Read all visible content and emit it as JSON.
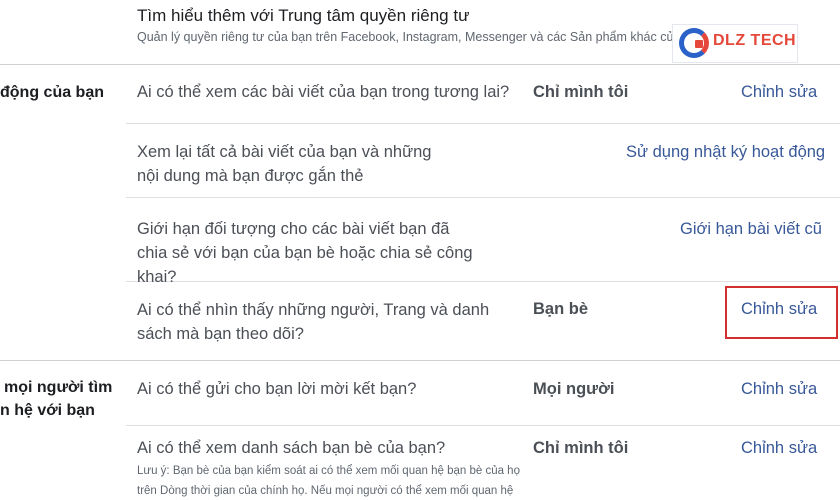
{
  "header": {
    "title": "Tìm hiểu thêm với Trung tâm quyền riêng tư",
    "subtitle": "Quản lý quyền riêng tư của bạn trên Facebook, Instagram, Messenger và các Sản phẩm khác của Meta"
  },
  "watermark": {
    "brand": "DLZ TECH"
  },
  "sections": [
    {
      "label": "động của bạn",
      "rows": [
        {
          "question": "Ai có thể xem các bài viết của bạn trong tương lai?",
          "value": "Chỉ mình tôi",
          "action": "Chỉnh sửa"
        },
        {
          "question": "Xem lại tất cả bài viết của bạn và những nội dung mà bạn được gắn thẻ",
          "value": "",
          "action": "Sử dụng nhật ký hoạt động"
        },
        {
          "question": "Giới hạn đối tượng cho các bài viết bạn đã chia sẻ với bạn của bạn bè hoặc chia sẻ công khai?",
          "value": "",
          "action": "Giới hạn bài viết cũ"
        },
        {
          "question": "Ai có thể nhìn thấy những người, Trang và danh sách mà bạn theo dõi?",
          "value": "Bạn bè",
          "action": "Chỉnh sửa"
        }
      ]
    },
    {
      "label_line1": "mọi người tìm",
      "label_line2": "n hệ với bạn",
      "rows": [
        {
          "question": "Ai có thể gửi cho bạn lời mời kết bạn?",
          "value": "Mọi người",
          "action": "Chỉnh sửa"
        },
        {
          "question": "Ai có thể xem danh sách bạn bè của bạn?",
          "value": "Chỉ mình tôi",
          "action": "Chỉnh sửa",
          "note": "Lưu ý: Bạn bè của bạn kiểm soát ai có thể xem mối quan hệ bạn bè của họ trên Dòng thời gian của chính họ. Nếu mọi người có thể xem mối quan hệ bạn"
        }
      ]
    }
  ],
  "colors": {
    "link": "#385898",
    "highlight": "#d32f2f",
    "text": "#4b4f56"
  }
}
